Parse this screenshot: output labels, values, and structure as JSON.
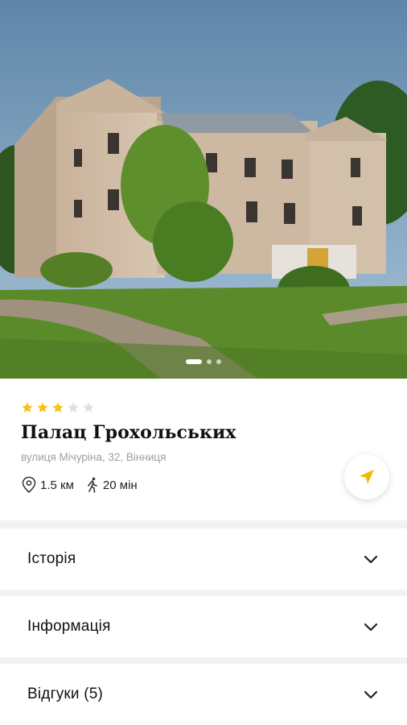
{
  "place": {
    "rating": 3,
    "max_rating": 5,
    "name": "Палац Грохольських",
    "address": "вулиця Мічуріна, 32, Вінниця",
    "distance": "1.5 км",
    "walk_time": "20 мін"
  },
  "carousel": {
    "slide_count": 3,
    "active_index": 0
  },
  "sections": [
    {
      "label": "Історія"
    },
    {
      "label": "Інформація"
    },
    {
      "label": "Відгуки (5)"
    }
  ],
  "colors": {
    "star_active": "#f5c218",
    "star_inactive": "#e0e0e0",
    "accent": "#f5b800",
    "text_secondary": "#9e9e9e"
  },
  "icons": {
    "location": "location-pin-icon",
    "walk": "walking-person-icon",
    "navigate": "navigation-arrow-icon",
    "expand": "chevron-down-icon"
  }
}
